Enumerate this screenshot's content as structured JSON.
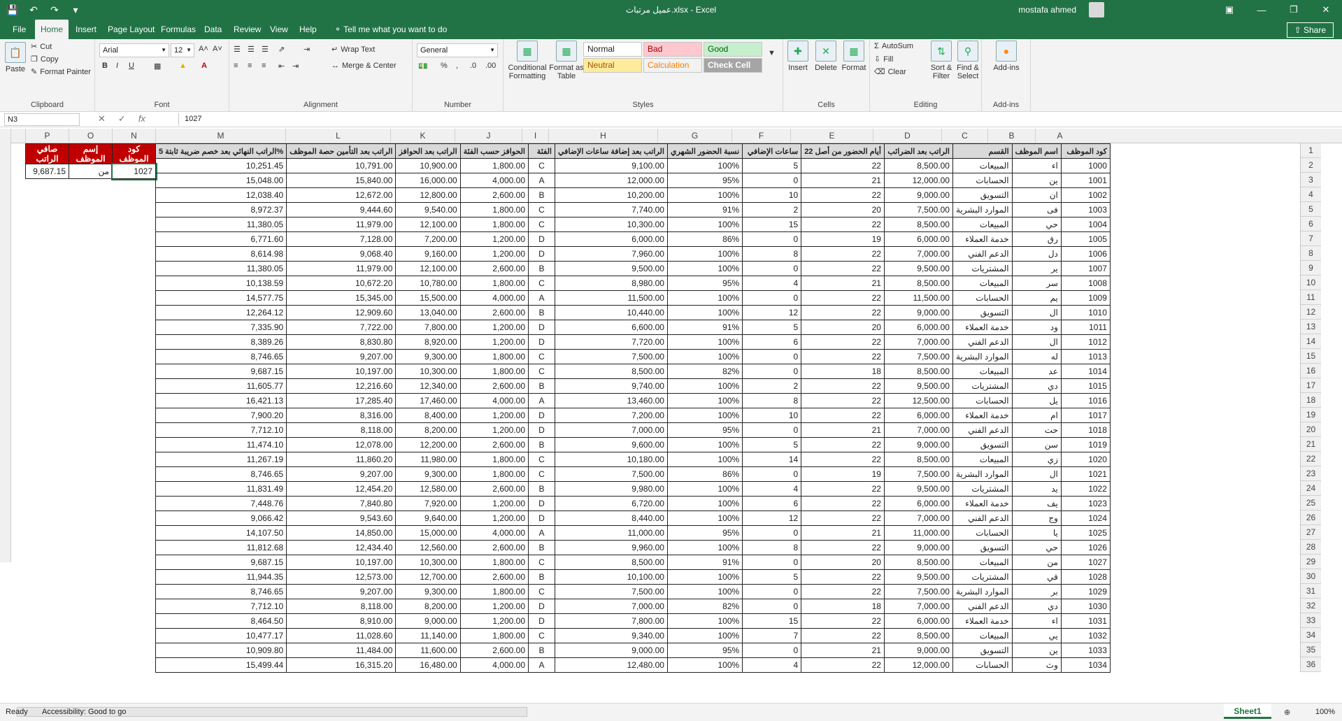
{
  "window": {
    "title": "عميل مرتبات.xlsx - Excel",
    "user": "mostafa ahmed",
    "share_label": "Share"
  },
  "tabs": [
    {
      "label": "File"
    },
    {
      "label": "Home"
    },
    {
      "label": "Insert"
    },
    {
      "label": "Page Layout"
    },
    {
      "label": "Formulas"
    },
    {
      "label": "Data"
    },
    {
      "label": "Review"
    },
    {
      "label": "View"
    },
    {
      "label": "Help"
    },
    {
      "label": "Tell me what you want to do"
    }
  ],
  "ribbon": {
    "clipboard": {
      "label": "Clipboard",
      "paste": "Paste",
      "cut": "Cut",
      "copy": "Copy",
      "format_painter": "Format Painter"
    },
    "font": {
      "label": "Font",
      "name": "Arial",
      "size": "12"
    },
    "alignment": {
      "label": "Alignment",
      "wrap": "Wrap Text",
      "merge": "Merge & Center"
    },
    "number": {
      "label": "Number",
      "format": "General"
    },
    "styles": {
      "label": "Styles",
      "conditional": "Conditional Formatting",
      "format_table": "Format as Table",
      "normal": "Normal",
      "bad": "Bad",
      "good": "Good",
      "neutral": "Neutral",
      "calculation": "Calculation",
      "check": "Check Cell"
    },
    "cells": {
      "label": "Cells",
      "insert": "Insert",
      "delete": "Delete",
      "format": "Format"
    },
    "editing": {
      "label": "Editing",
      "autosum": "AutoSum",
      "fill": "Fill",
      "clear": "Clear",
      "sort": "Sort & Filter",
      "find": "Find & Select"
    },
    "addins": {
      "label": "Add-ins",
      "addins": "Add-ins"
    }
  },
  "formula_bar": {
    "name_box": "N3",
    "value": "1027"
  },
  "columns": [
    "P",
    "O",
    "N",
    "M",
    "L",
    "K",
    "J",
    "I",
    "H",
    "G",
    "F",
    "E",
    "D",
    "C",
    "B",
    "A"
  ],
  "headers": {
    "A": "كود الموظف",
    "B": "اسم الموظف",
    "C": "القسم",
    "D": "الراتب بعد الضرائب",
    "E": "أيام الحضور من أصل 22",
    "F": "ساعات الإضافي",
    "G": "نسبة الحضور الشهري",
    "H": "الراتب بعد إضافة ساعات الإضافي",
    "I": "الفئة",
    "J": "الحوافز حسب الفئة",
    "K": "الراتب بعد الحوافز",
    "L": "الراتب بعد التأمين حصة الموظف",
    "M": "الراتب النهائي بعد خصم ضريبة ثابتة 5%"
  },
  "lookup": {
    "h_code": "كود الموظف",
    "h_name": "إسم الموظف",
    "h_net": "صافي الراتب",
    "code": "1027",
    "name": "من",
    "net": "9,687.15"
  },
  "rows": [
    [
      "1000",
      "اء",
      "المبيعات",
      "8,500.00",
      "22",
      "5",
      "100%",
      "9,100.00",
      "C",
      "1,800.00",
      "10,900.00",
      "10,791.00",
      "10,251.45"
    ],
    [
      "1001",
      "ين",
      "الحسابات",
      "12,000.00",
      "21",
      "0",
      "95%",
      "12,000.00",
      "A",
      "4,000.00",
      "16,000.00",
      "15,840.00",
      "15,048.00"
    ],
    [
      "1002",
      "ان",
      "التسويق",
      "9,000.00",
      "22",
      "10",
      "100%",
      "10,200.00",
      "B",
      "2,600.00",
      "12,800.00",
      "12,672.00",
      "12,038.40"
    ],
    [
      "1003",
      "فى",
      "الموارد البشرية",
      "7,500.00",
      "20",
      "2",
      "91%",
      "7,740.00",
      "C",
      "1,800.00",
      "9,540.00",
      "9,444.60",
      "8,972.37"
    ],
    [
      "1004",
      "حي",
      "المبيعات",
      "8,500.00",
      "22",
      "15",
      "100%",
      "10,300.00",
      "C",
      "1,800.00",
      "12,100.00",
      "11,979.00",
      "11,380.05"
    ],
    [
      "1005",
      "رق",
      "خدمة العملاء",
      "6,000.00",
      "19",
      "0",
      "86%",
      "6,000.00",
      "D",
      "1,200.00",
      "7,200.00",
      "7,128.00",
      "6,771.60"
    ],
    [
      "1006",
      "دل",
      "الدعم الفني",
      "7,000.00",
      "22",
      "8",
      "100%",
      "7,960.00",
      "D",
      "1,200.00",
      "9,160.00",
      "9,068.40",
      "8,614.98"
    ],
    [
      "1007",
      "ير",
      "المشتريات",
      "9,500.00",
      "22",
      "0",
      "100%",
      "9,500.00",
      "B",
      "2,600.00",
      "12,100.00",
      "11,979.00",
      "11,380.05"
    ],
    [
      "1008",
      "سر",
      "المبيعات",
      "8,500.00",
      "21",
      "4",
      "95%",
      "8,980.00",
      "C",
      "1,800.00",
      "10,780.00",
      "10,672.20",
      "10,138.59"
    ],
    [
      "1009",
      "يم",
      "الحسابات",
      "11,500.00",
      "22",
      "0",
      "100%",
      "11,500.00",
      "A",
      "4,000.00",
      "15,500.00",
      "15,345.00",
      "14,577.75"
    ],
    [
      "1010",
      "ال",
      "التسويق",
      "9,000.00",
      "22",
      "12",
      "100%",
      "10,440.00",
      "B",
      "2,600.00",
      "13,040.00",
      "12,909.60",
      "12,264.12"
    ],
    [
      "1011",
      "ود",
      "خدمة العملاء",
      "6,000.00",
      "20",
      "5",
      "91%",
      "6,600.00",
      "D",
      "1,200.00",
      "7,800.00",
      "7,722.00",
      "7,335.90"
    ],
    [
      "1012",
      "ال",
      "الدعم الفني",
      "7,000.00",
      "22",
      "6",
      "100%",
      "7,720.00",
      "D",
      "1,200.00",
      "8,920.00",
      "8,830.80",
      "8,389.26"
    ],
    [
      "1013",
      "له",
      "الموارد البشرية",
      "7,500.00",
      "22",
      "0",
      "100%",
      "7,500.00",
      "C",
      "1,800.00",
      "9,300.00",
      "9,207.00",
      "8,746.65"
    ],
    [
      "1014",
      "عد",
      "المبيعات",
      "8,500.00",
      "18",
      "0",
      "82%",
      "8,500.00",
      "C",
      "1,800.00",
      "10,300.00",
      "10,197.00",
      "9,687.15"
    ],
    [
      "1015",
      "دي",
      "المشتريات",
      "9,500.00",
      "22",
      "2",
      "100%",
      "9,740.00",
      "B",
      "2,600.00",
      "12,340.00",
      "12,216.60",
      "11,605.77"
    ],
    [
      "1016",
      "يل",
      "الحسابات",
      "12,500.00",
      "22",
      "8",
      "100%",
      "13,460.00",
      "A",
      "4,000.00",
      "17,460.00",
      "17,285.40",
      "16,421.13"
    ],
    [
      "1017",
      "ام",
      "خدمة العملاء",
      "6,000.00",
      "22",
      "10",
      "100%",
      "7,200.00",
      "D",
      "1,200.00",
      "8,400.00",
      "8,316.00",
      "7,900.20"
    ],
    [
      "1018",
      "حت",
      "الدعم الفني",
      "7,000.00",
      "21",
      "0",
      "95%",
      "7,000.00",
      "D",
      "1,200.00",
      "8,200.00",
      "8,118.00",
      "7,712.10"
    ],
    [
      "1019",
      "سن",
      "التسويق",
      "9,000.00",
      "22",
      "5",
      "100%",
      "9,600.00",
      "B",
      "2,600.00",
      "12,200.00",
      "12,078.00",
      "11,474.10"
    ],
    [
      "1020",
      "زي",
      "المبيعات",
      "8,500.00",
      "22",
      "14",
      "100%",
      "10,180.00",
      "C",
      "1,800.00",
      "11,980.00",
      "11,860.20",
      "11,267.19"
    ],
    [
      "1021",
      "ال",
      "الموارد البشرية",
      "7,500.00",
      "19",
      "0",
      "86%",
      "7,500.00",
      "C",
      "1,800.00",
      "9,300.00",
      "9,207.00",
      "8,746.65"
    ],
    [
      "1022",
      "يد",
      "المشتريات",
      "9,500.00",
      "22",
      "4",
      "100%",
      "9,980.00",
      "B",
      "2,600.00",
      "12,580.00",
      "12,454.20",
      "11,831.49"
    ],
    [
      "1023",
      "يف",
      "خدمة العملاء",
      "6,000.00",
      "22",
      "6",
      "100%",
      "6,720.00",
      "D",
      "1,200.00",
      "7,920.00",
      "7,840.80",
      "7,448.76"
    ],
    [
      "1024",
      "وج",
      "الدعم الفني",
      "7,000.00",
      "22",
      "12",
      "100%",
      "8,440.00",
      "D",
      "1,200.00",
      "9,640.00",
      "9,543.60",
      "9,066.42"
    ],
    [
      "1025",
      "يا",
      "الحسابات",
      "11,000.00",
      "21",
      "0",
      "95%",
      "11,000.00",
      "A",
      "4,000.00",
      "15,000.00",
      "14,850.00",
      "14,107.50"
    ],
    [
      "1026",
      "حي",
      "التسويق",
      "9,000.00",
      "22",
      "8",
      "100%",
      "9,960.00",
      "B",
      "2,600.00",
      "12,560.00",
      "12,434.40",
      "11,812.68"
    ],
    [
      "1027",
      "من",
      "المبيعات",
      "8,500.00",
      "20",
      "0",
      "91%",
      "8,500.00",
      "C",
      "1,800.00",
      "10,300.00",
      "10,197.00",
      "9,687.15"
    ],
    [
      "1028",
      "قي",
      "المشتريات",
      "9,500.00",
      "22",
      "5",
      "100%",
      "10,100.00",
      "B",
      "2,600.00",
      "12,700.00",
      "12,573.00",
      "11,944.35"
    ],
    [
      "1029",
      "بر",
      "الموارد البشرية",
      "7,500.00",
      "22",
      "0",
      "100%",
      "7,500.00",
      "C",
      "1,800.00",
      "9,300.00",
      "9,207.00",
      "8,746.65"
    ],
    [
      "1030",
      "دي",
      "الدعم الفني",
      "7,000.00",
      "18",
      "0",
      "82%",
      "7,000.00",
      "D",
      "1,200.00",
      "8,200.00",
      "8,118.00",
      "7,712.10"
    ],
    [
      "1031",
      "اء",
      "خدمة العملاء",
      "6,000.00",
      "22",
      "15",
      "100%",
      "7,800.00",
      "D",
      "1,200.00",
      "9,000.00",
      "8,910.00",
      "8,464.50"
    ],
    [
      "1032",
      "يي",
      "المبيعات",
      "8,500.00",
      "22",
      "7",
      "100%",
      "9,340.00",
      "C",
      "1,800.00",
      "11,140.00",
      "11,028.60",
      "10,477.17"
    ],
    [
      "1033",
      "ين",
      "التسويق",
      "9,000.00",
      "21",
      "0",
      "95%",
      "9,000.00",
      "B",
      "2,600.00",
      "11,600.00",
      "11,484.00",
      "10,909.80"
    ],
    [
      "1034",
      "وث",
      "الحسابات",
      "12,000.00",
      "22",
      "4",
      "100%",
      "12,480.00",
      "A",
      "4,000.00",
      "16,480.00",
      "16,315.20",
      "15,499.44"
    ]
  ],
  "status": {
    "ready": "Ready",
    "accessibility": "Accessibility: Good to go",
    "sheet": "Sheet1",
    "zoom": "100%"
  }
}
